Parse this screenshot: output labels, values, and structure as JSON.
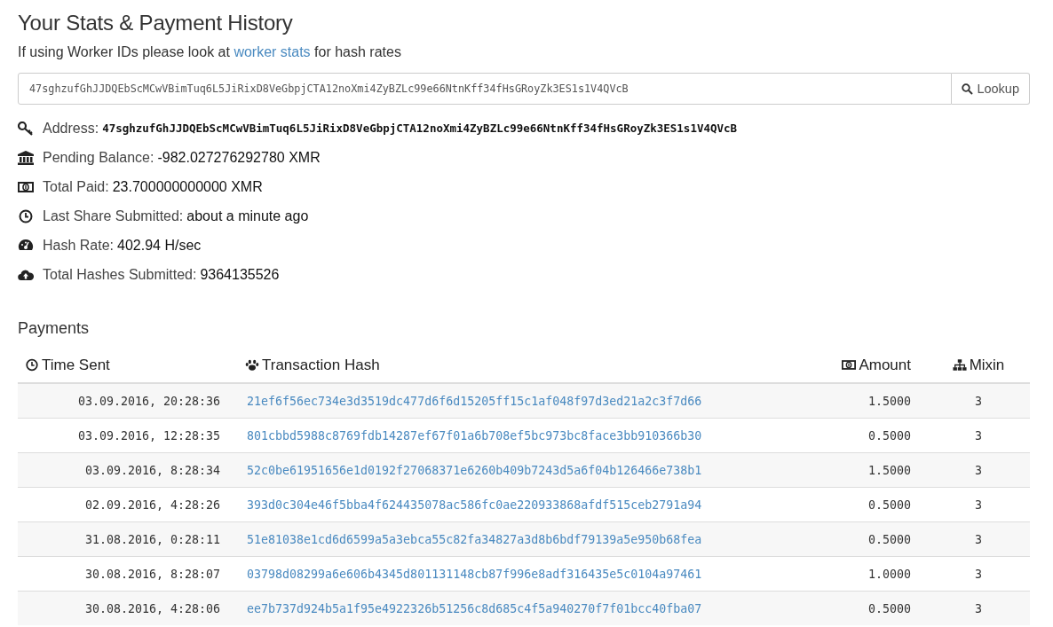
{
  "heading": "Your Stats & Payment History",
  "note": {
    "before": "If using Worker IDs please look at ",
    "link": "worker stats",
    "after": " for hash rates"
  },
  "lookup": {
    "value": "47sghzufGhJJDQEbScMCwVBimTuq6L5JiRixD8VeGbpjCTA12noXmi4ZyBZLc99e66NtnKff34fHsGRoyZk3ES1s1V4QVcB",
    "button": "Lookup"
  },
  "stats": [
    {
      "kind": "key",
      "label": "Address:",
      "value": "47sghzufGhJJDQEbScMCwVBimTuq6L5JiRixD8VeGbpjCTA12noXmi4ZyBZLc99e66NtnKff34fHsGRoyZk3ES1s1V4QVcB"
    },
    {
      "kind": "bank",
      "label": "Pending Balance:",
      "value": "-982.027276292780 XMR"
    },
    {
      "kind": "money",
      "label": "Total Paid:",
      "value": "23.700000000000 XMR"
    },
    {
      "kind": "clock",
      "label": "Last Share Submitted:",
      "value": "about a minute ago"
    },
    {
      "kind": "gauge",
      "label": "Hash Rate:",
      "value": "402.94 H/sec"
    },
    {
      "kind": "upload",
      "label": "Total Hashes Submitted:",
      "value": "9364135526"
    }
  ],
  "payments": {
    "title": "Payments",
    "columns": [
      {
        "kind": "clock",
        "label": "Time Sent"
      },
      {
        "kind": "paw",
        "label": "Transaction Hash"
      },
      {
        "kind": "money",
        "label": "Amount"
      },
      {
        "kind": "sitemap",
        "label": "Mixin"
      }
    ],
    "rows": [
      [
        "03.09.2016, 20:28:36",
        "21ef6f56ec734e3d3519dc477d6f6d15205ff15c1af048f97d3ed21a2c3f7d66",
        "1.5000",
        "3"
      ],
      [
        "03.09.2016, 12:28:35",
        "801cbbd5988c8769fdb14287ef67f01a6b708ef5bc973bc8face3bb910366b30",
        "0.5000",
        "3"
      ],
      [
        "03.09.2016, 8:28:34",
        "52c0be61951656e1d0192f27068371e6260b409b7243d5a6f04b126466e738b1",
        "1.5000",
        "3"
      ],
      [
        "02.09.2016, 4:28:26",
        "393d0c304e46f5bba4f624435078ac586fc0ae220933868afdf515ceb2791a94",
        "0.5000",
        "3"
      ],
      [
        "31.08.2016, 0:28:11",
        "51e81038e1cd6d6599a5a3ebca55c82fa34827a3d8b6bdf79139a5e950b68fea",
        "0.5000",
        "3"
      ],
      [
        "30.08.2016, 8:28:07",
        "03798d08299a6e606b4345d801131148cb87f996e8adf316435e5c0104a97461",
        "1.0000",
        "3"
      ],
      [
        "30.08.2016, 4:28:06",
        "ee7b737d924b5a1f95e4922326b51256c8d685c4f5a940270f7f01bcc40fba07",
        "0.5000",
        "3"
      ]
    ]
  }
}
